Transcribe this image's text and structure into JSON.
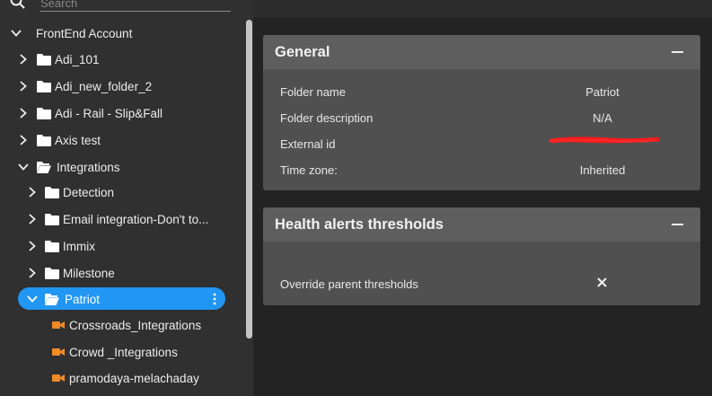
{
  "search": {
    "placeholder": "Search"
  },
  "tree": {
    "root": {
      "label": "FrontEnd Account"
    },
    "items": [
      {
        "label": "Adi_101"
      },
      {
        "label": "Adi_new_folder_2"
      },
      {
        "label": "Adi - Rail - Slip&Fall"
      },
      {
        "label": "Axis test"
      },
      {
        "label": "Integrations"
      },
      {
        "label": "Detection"
      },
      {
        "label": "Email integration-Don't to..."
      },
      {
        "label": "Immix"
      },
      {
        "label": "Milestone"
      },
      {
        "label": "Patriot"
      },
      {
        "label": "Crossroads_Integrations"
      },
      {
        "label": "Crowd _Integrations"
      },
      {
        "label": "pramodaya-melachaday"
      }
    ]
  },
  "general": {
    "title": "General",
    "fields": [
      {
        "label": "Folder name",
        "value": "Patriot"
      },
      {
        "label": "Folder description",
        "value": "N/A"
      },
      {
        "label": "External id",
        "value": ""
      },
      {
        "label": "Time zone:",
        "value": "Inherited"
      }
    ]
  },
  "health": {
    "title": "Health alerts thresholds",
    "fields": [
      {
        "label": "Override parent thresholds"
      }
    ]
  },
  "colors": {
    "accent": "#2196f3",
    "camera": "#f08a24",
    "redaction": "#ff1a1a"
  },
  "icons": [
    "search-icon",
    "chevron-right-icon",
    "chevron-down-icon",
    "folder-icon",
    "folder-open-icon",
    "camera-icon",
    "more-vert-icon",
    "minus-icon",
    "close-icon"
  ]
}
